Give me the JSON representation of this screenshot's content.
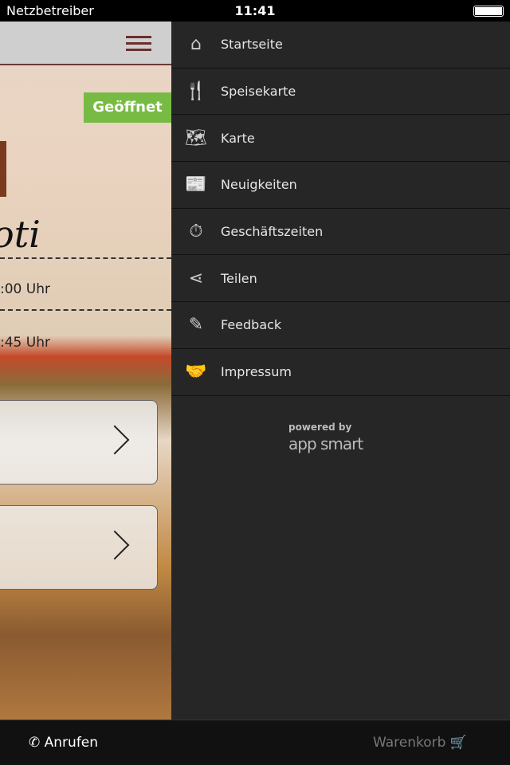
{
  "status": {
    "carrier": "Netzbetreiber",
    "time": "11:41"
  },
  "main": {
    "badge": "Geöffnet",
    "logo_text": "oti",
    "hours": [
      ":00 Uhr",
      ":45 Uhr"
    ]
  },
  "menu": {
    "items": [
      {
        "label": "Startseite",
        "icon": "⌂"
      },
      {
        "label": "Speisekarte",
        "icon": "🍴"
      },
      {
        "label": "Karte",
        "icon": "🗺"
      },
      {
        "label": "Neuigkeiten",
        "icon": "📰"
      },
      {
        "label": "Geschäftszeiten",
        "icon": "⏱"
      },
      {
        "label": "Teilen",
        "icon": "⋖"
      },
      {
        "label": "Feedback",
        "icon": "✎"
      },
      {
        "label": "Impressum",
        "icon": "🤝"
      }
    ]
  },
  "powered": {
    "label": "powered by",
    "brand": "app smart"
  },
  "bottom": {
    "call": "Anrufen",
    "call_icon": "✆",
    "cart": "Warenkorb",
    "cart_icon": "🛒"
  },
  "colors": {
    "badge": "#77bb44",
    "drawer": "#262626",
    "accent": "#6b2e2e"
  }
}
